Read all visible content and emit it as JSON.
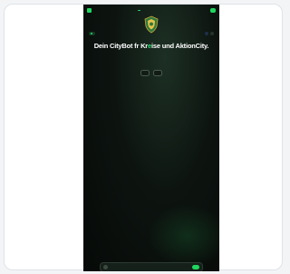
{
  "colors": {
    "accent": "#1ed760",
    "headline_highlight": "#22e06b",
    "background_dark": "#0d1410",
    "outer_frame": "#ffffff"
  },
  "header": {
    "brand_icon": "logo-mark-icon",
    "nav_items": [
      {
        "label": "",
        "active": false
      },
      {
        "label": "",
        "active": false
      },
      {
        "label": "",
        "active": true
      },
      {
        "label": "",
        "active": false
      },
      {
        "label": "",
        "active": false
      }
    ],
    "cta_label": ""
  },
  "emblem": {
    "icon": "shield-crest-icon"
  },
  "badges": {
    "left_label": "",
    "right_labels": [
      "",
      ""
    ]
  },
  "hero": {
    "title_before": "Dein CityBot f",
    "title_mid": "r Kr",
    "title_highlight": "e",
    "title_after": "ise und AktionCity."
  },
  "actions": [
    {
      "label": ""
    },
    {
      "label": ""
    }
  ],
  "bottom_bar": {
    "label": "",
    "button_label": ""
  }
}
